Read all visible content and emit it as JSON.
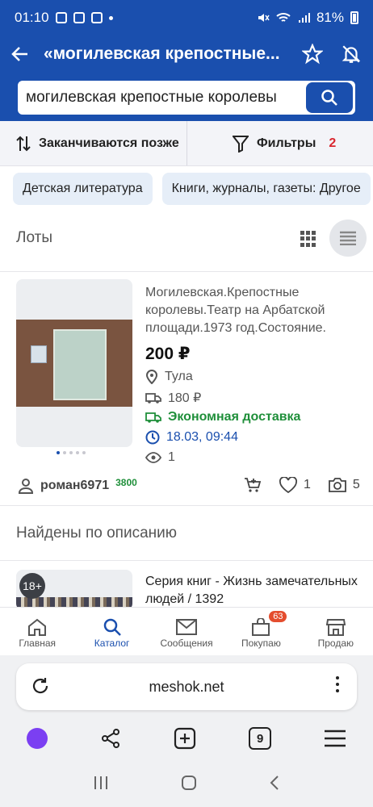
{
  "status": {
    "time": "01:10",
    "battery": "81%"
  },
  "appbar": {
    "title": "«могилевская крепостные..."
  },
  "search": {
    "value": "могилевская крепостные королевы"
  },
  "sort": {
    "label": "Заканчиваются позже"
  },
  "filter": {
    "label": "Фильтры",
    "count": "2"
  },
  "chips": [
    "Детская литература",
    "Книги, журналы, газеты: Другое"
  ],
  "lots_heading": "Лоты",
  "lot": {
    "title": "Могилевская.Крепостные королевы.Театр на Арбатской площади.1973 год.Состояние.",
    "price": "200 ₽",
    "city": "Тула",
    "shipping": "180 ₽",
    "delivery": "Экономная доставка",
    "ends": "18.03, 09:44",
    "views": "1",
    "seller": "роман6971",
    "rating": "3800",
    "likes": "1",
    "photos": "5"
  },
  "found_heading": "Найдены по описанию",
  "lot2": {
    "badge": "18+",
    "title": "Серия книг - Жизнь замечательных людей / 1392"
  },
  "tabbar": {
    "home": "Главная",
    "catalog": "Каталог",
    "messages": "Сообщения",
    "buying": "Покупаю",
    "buying_badge": "63",
    "selling": "Продаю"
  },
  "browser": {
    "url": "meshok.net",
    "tabs_count": "9"
  },
  "colors": {
    "brand": "#1a4fae",
    "green": "#1f8f3a",
    "red": "#d9262e"
  }
}
